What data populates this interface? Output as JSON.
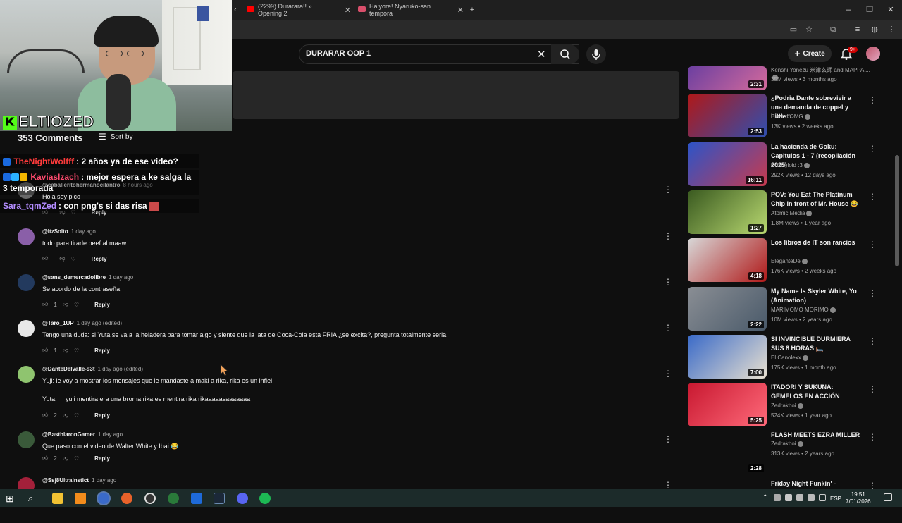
{
  "browser": {
    "tabs": [
      {
        "label": "(2299) Durarara!! » Opening 2",
        "favicon_color": "#ff0000"
      },
      {
        "label": "Haiyore! Nyaruko-san tempora",
        "favicon_color": "#d94f6b"
      }
    ],
    "new_tab_icon": "plus-icon"
  },
  "youtube": {
    "search_value": "DURARAR OOP 1",
    "create_label": "Create",
    "notif_count": "9+"
  },
  "stream_overlay": {
    "streamer_name": "ELTIOZED",
    "kick_letter": "K",
    "chat": [
      {
        "user": "TheNightWolfff",
        "message": ": 2 años ya de ese video?",
        "user_color": "#ff3b3b"
      },
      {
        "user": "KaviasIzach",
        "message": ": mejor espera a ke salga la 3 temporada",
        "user_color": "#ff4b6e"
      },
      {
        "user": "Sara_tqmZed",
        "message": ": con png's si das risa",
        "user_color": "#b38cff"
      }
    ]
  },
  "comments_section": {
    "count_label": "353 Comments",
    "sort_label": "Sort by",
    "comments": [
      {
        "handle": "@caballeritohermanocilantro",
        "time": "8 hours ago",
        "text": "Hola soy pico",
        "likes": "",
        "reply": "Reply",
        "avatar_color": "#6a6a6a"
      },
      {
        "handle": "@ItzSolto",
        "time": "1 day ago",
        "text": "todo para tirarle beef al maaw",
        "likes": "",
        "reply": "Reply",
        "avatar_color": "#8a5fa8"
      },
      {
        "handle": "@sans_demercadolibre",
        "time": "1 day ago",
        "text": "Se acordo de la contraseña",
        "likes": "1",
        "reply": "Reply",
        "avatar_color": "#233a5e"
      },
      {
        "handle": "@Taro_1UP",
        "time": "1 day ago (edited)",
        "text": "Tengo una duda: si Yuta se va a la heladera para tomar algo y siente que la lata de Coca-Cola esta FRIA ¿se excita?, pregunta totalmente seria.",
        "likes": "1",
        "reply": "Reply",
        "avatar_color": "#e8e8e8"
      },
      {
        "handle": "@DanteDelvalle-s3t",
        "time": "1 day ago (edited)",
        "text": "Yuji: le voy a mostrar los mensajes que le mandaste a maki a rika, rika es un infiel\n\nYuta:     yuji mentira era una broma rika es mentira rika rikaaaaasaaaaaaa",
        "likes": "2",
        "reply": "Reply",
        "avatar_color": "#8fc46f"
      },
      {
        "handle": "@BasthiaronGamer",
        "time": "1 day ago",
        "text": "Que paso con el video de Walter White y Ibai 😂",
        "likes": "2",
        "reply": "Reply",
        "avatar_color": "#3a5a3a"
      },
      {
        "handle": "@Ssj8UltraInstict",
        "time": "1 day ago",
        "text": "",
        "likes": "",
        "reply": "",
        "avatar_color": "#a3203a"
      }
    ]
  },
  "recommendations": [
    {
      "title": "",
      "channel": "Kenshi Yonezu 米津玄師 and MAPPA ...",
      "meta": "35M views • 3 months ago",
      "duration": "2:31",
      "thumb": [
        "#6b3fa0",
        "#d46a9c"
      ]
    },
    {
      "title": "¿Podria Dante sobrevivir a una demanda de coppel y Little ...",
      "channel": "BlastoffOMG",
      "meta": "13K views • 2 weeks ago",
      "duration": "2:53",
      "thumb": [
        "#b01818",
        "#2f4fb0"
      ]
    },
    {
      "title": "La hacienda de Goku: Capitulos 1 - 7 (recopilación 2025)",
      "channel": "Crisferloid :3",
      "meta": "292K views • 12 days ago",
      "duration": "16:11",
      "thumb": [
        "#2c54c8",
        "#c73a4e"
      ]
    },
    {
      "title": "POV: You Eat The Platinum Chip In front of Mr. House 😂",
      "channel": "Atomic Media",
      "meta": "1.8M views • 1 year ago",
      "duration": "1:27",
      "thumb": [
        "#3a5a20",
        "#b8d870"
      ]
    },
    {
      "title": "Los libros de IT son rancios",
      "channel": "EleganteDe",
      "meta": "176K views • 2 weeks ago",
      "duration": "4:18",
      "thumb": [
        "#d8d8d8",
        "#b01818"
      ]
    },
    {
      "title": "My Name Is Skyler White, Yo (Animation)",
      "channel": "MARIMOMO MORIMO",
      "meta": "10M views • 2 years ago",
      "duration": "2:22",
      "thumb": [
        "#8a8e94",
        "#4a5a6a"
      ]
    },
    {
      "title": "SI INVINCIBLE DURMIERA SUS 8 HORAS 🛏️",
      "channel": "El Canolexx",
      "meta": "175K views • 1 month ago",
      "duration": "7:00",
      "thumb": [
        "#3a6ac8",
        "#e8e0d0"
      ]
    },
    {
      "title": "ITADORI Y SUKUNA: GEMELOS EN ACCIÓN",
      "channel": "Zedrakboi",
      "meta": "524K views • 1 year ago",
      "duration": "5:25",
      "thumb": [
        "#c81830",
        "#ff6a7a"
      ]
    },
    {
      "title": "FLASH MEETS EZRA MILLER",
      "channel": "Zedrakboi",
      "meta": "313K views • 2 years ago",
      "duration": "2:28",
      "thumb": [
        "#0f0f0f",
        "#0f0f0f"
      ]
    },
    {
      "title": "Friday Night Funkin' -",
      "channel": "",
      "meta": "",
      "duration": "",
      "thumb": [
        "#0f0f0f",
        "#0f0f0f"
      ]
    }
  ],
  "taskbar": {
    "time": "19:51",
    "date": "7/01/2026",
    "lang": "ESP"
  }
}
